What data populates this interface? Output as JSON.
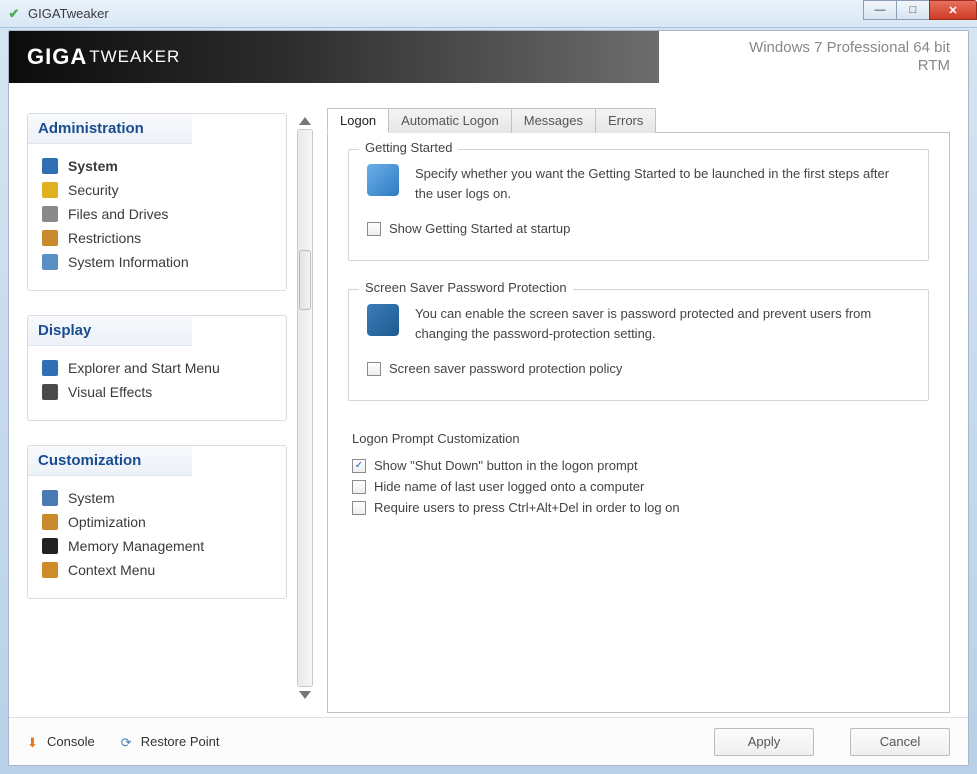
{
  "window": {
    "title": "GIGATweaker"
  },
  "header": {
    "brand_big": "GIGA",
    "brand_small": "TWEAKER",
    "os_line1": "Windows 7 Professional 64 bit",
    "os_line2": "RTM"
  },
  "sidebar": {
    "groups": [
      {
        "title": "Administration",
        "items": [
          {
            "label": "System",
            "active": true,
            "icon_color": "#2f6fb3"
          },
          {
            "label": "Security",
            "icon_color": "#e0b020"
          },
          {
            "label": "Files and Drives",
            "icon_color": "#8a8a8a"
          },
          {
            "label": "Restrictions",
            "icon_color": "#c88a2a"
          },
          {
            "label": "System Information",
            "icon_color": "#5a8fc4"
          }
        ]
      },
      {
        "title": "Display",
        "items": [
          {
            "label": "Explorer and Start Menu",
            "icon_color": "#2f6fb3"
          },
          {
            "label": "Visual Effects",
            "icon_color": "#4a4a4a"
          }
        ]
      },
      {
        "title": "Customization",
        "items": [
          {
            "label": "System",
            "icon_color": "#4a79b3"
          },
          {
            "label": "Optimization",
            "icon_color": "#c88a2a"
          },
          {
            "label": "Memory Management",
            "icon_color": "#222"
          },
          {
            "label": "Context Menu",
            "icon_color": "#d08a2a"
          }
        ]
      }
    ]
  },
  "tabs": {
    "items": [
      {
        "label": "Logon",
        "active": true
      },
      {
        "label": "Automatic Logon"
      },
      {
        "label": "Messages"
      },
      {
        "label": "Errors"
      }
    ]
  },
  "panel": {
    "group1": {
      "title": "Getting Started",
      "desc": "Specify whether you want the Getting Started to be launched in the first steps after the user logs on.",
      "check1": "Show Getting Started at startup",
      "check1_checked": false
    },
    "group2": {
      "title": "Screen Saver Password Protection",
      "desc": "You can enable the screen saver is password protected and prevent users from changing the password-protection setting.",
      "check1": "Screen saver password protection policy",
      "check1_checked": false
    },
    "group3": {
      "title": "Logon Prompt Customization",
      "check1": "Show \"Shut Down\" button in the logon prompt",
      "check1_checked": true,
      "check2": "Hide name of last user logged onto a computer",
      "check2_checked": false,
      "check3": "Require users to press Ctrl+Alt+Del in order to log on",
      "check3_checked": false
    }
  },
  "footer": {
    "console": "Console",
    "restore": "Restore Point",
    "apply": "Apply",
    "cancel": "Cancel"
  }
}
